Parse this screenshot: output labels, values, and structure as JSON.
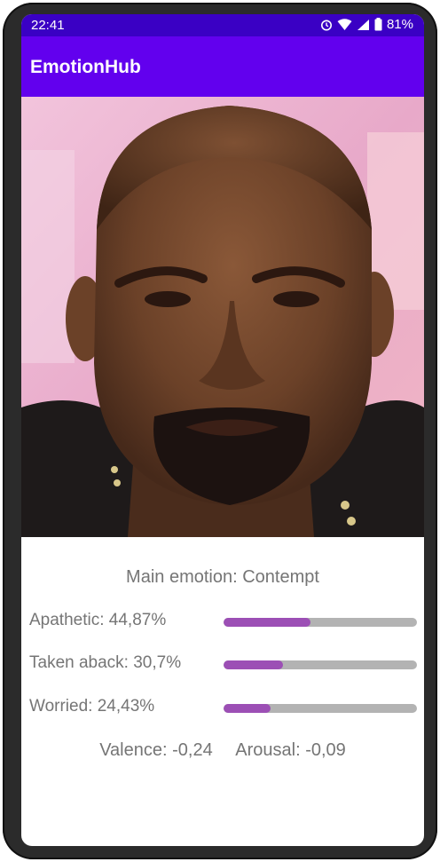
{
  "status_bar": {
    "time": "22:41",
    "battery": "81%",
    "icons": [
      "alarm-icon",
      "wifi-icon",
      "signal-icon",
      "battery-icon"
    ]
  },
  "app_bar": {
    "title": "EmotionHub",
    "color": "#6200ee"
  },
  "photo": {
    "description_icon": "face-photo"
  },
  "result": {
    "main_emotion": "Main emotion: Contempt",
    "emotions": [
      {
        "label": "Apathetic: 44,87%",
        "fraction": 0.4487
      },
      {
        "label": "Taken aback: 30,7%",
        "fraction": 0.307
      },
      {
        "label": "Worried: 24,43%",
        "fraction": 0.2443
      }
    ],
    "valence": "Valence: -0,24",
    "arousal": "Arousal: -0,09"
  },
  "colors": {
    "accent": "#6200ee",
    "status_bar": "#3a00c4",
    "bar_fill": "#9c4fb5",
    "bar_track": "#b3b3b3",
    "text": "#757575"
  }
}
